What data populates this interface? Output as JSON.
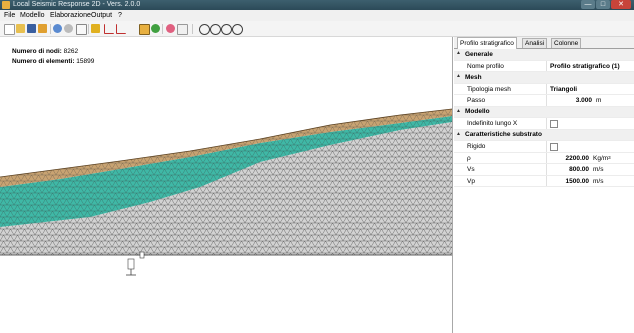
{
  "window": {
    "title": "Local Seismic Response 2D - Vers. 2.0.0",
    "controls": {
      "minimize": "—",
      "maximize": "□",
      "close": "✕"
    }
  },
  "menu": [
    "File",
    "Modello",
    "Elaborazione",
    "Output",
    "?"
  ],
  "toolbar": {
    "buttons": [
      "new",
      "open",
      "save",
      "save-as",
      "undo",
      "redo",
      "properties",
      "pencil",
      "chart-up",
      "chart-down",
      "grid",
      "nodes",
      "palette",
      "report",
      "zoom-in",
      "zoom-out",
      "zoom-fit",
      "zoom-window"
    ]
  },
  "canvas": {
    "nodes_label": "Numero di nodi:",
    "nodes_value": "8262",
    "elements_label": "Numero di elementi:",
    "elements_value": "15899",
    "layer_colors": {
      "top": "#c8a372",
      "middle": "#3fb8a6",
      "bottom": "#d2d2d2",
      "mesh": "#3a3a3a"
    }
  },
  "panel": {
    "tabs": [
      "Profilo stratigrafico",
      "Analisi",
      "Colonne"
    ],
    "active_tab": "Profilo stratigrafico",
    "sections": {
      "generale": {
        "title": "Generale",
        "nome_profilo_label": "Nome profilo",
        "nome_profilo_value": "Profilo stratigrafico (1)"
      },
      "mesh": {
        "title": "Mesh",
        "tipologia_label": "Tipologia mesh",
        "tipologia_value": "Triangoli",
        "passo_label": "Passo",
        "passo_value": "3.000",
        "passo_unit": "m"
      },
      "modello": {
        "title": "Modello",
        "indefinito_label": "Indefinito lungo X",
        "indefinito_checked": false
      },
      "substrato": {
        "title": "Caratteristiche substrato",
        "rigido_label": "Rigido",
        "rigido_checked": false,
        "rho_label": "ρ",
        "rho_value": "2200.00",
        "rho_unit": "Kg/m",
        "rho_unit_exp": "3",
        "vs_label": "Vs",
        "vs_value": "800.00",
        "vs_unit": "m/s",
        "vp_label": "Vp",
        "vp_value": "1500.00",
        "vp_unit": "m/s"
      }
    }
  }
}
